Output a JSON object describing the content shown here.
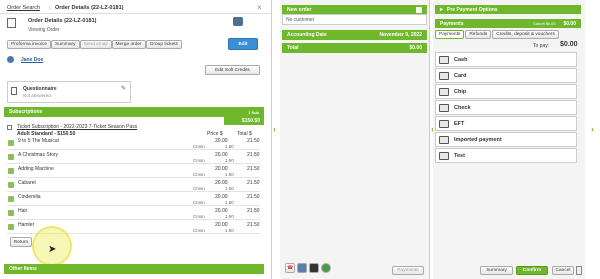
{
  "left": {
    "tabs": [
      "Order Search",
      "Order Details (22-LZ-0181)"
    ],
    "header_title": "Order Details (22-LZ-0181)",
    "header_sub": "Viewing Order",
    "edit_label": "Edit",
    "toolbar": [
      "Proforma invoice",
      "Summary",
      "Send email",
      "Merge order",
      "Group tickets"
    ],
    "customer_name": "Jane Doe",
    "edit_soft_credits": "Edit Soft Credits",
    "questionnaire_title": "Questionnaire",
    "questionnaire_status": "Not answered",
    "subscriptions": {
      "title": "Subscriptions",
      "count_label": "1 Sub",
      "total": "$150.50",
      "item_link": "Ticket Subscription - 2022-2023 7-Ticket Season Pass",
      "item_line": "Adult Standard - $150.50",
      "col_price": "Price $",
      "col_total": "Total $",
      "rows": [
        {
          "name": "9 to 5 The Musical",
          "price": "20.00",
          "total": "21.50",
          "comp": "Cmsn",
          "fee": "1.50"
        },
        {
          "name": "A Christmas Story",
          "price": "20.00",
          "total": "21.50",
          "comp": "Cmsn",
          "fee": "1.50"
        },
        {
          "name": "Adding Machine",
          "price": "20.00",
          "total": "21.50",
          "comp": "Cmsn",
          "fee": "1.50"
        },
        {
          "name": "Cabaret",
          "price": "20.00",
          "total": "21.50",
          "comp": "Cmsn",
          "fee": "1.50"
        },
        {
          "name": "Cinderella",
          "price": "20.00",
          "total": "21.50",
          "comp": "Cmsn",
          "fee": "1.50"
        },
        {
          "name": "Hair",
          "price": "20.00",
          "total": "21.50",
          "comp": "Cmsn",
          "fee": "1.50"
        },
        {
          "name": "Hamlet",
          "price": "20.00",
          "total": "21.50",
          "comp": "Cmsn",
          "fee": "1.50"
        }
      ],
      "return_label": "Return"
    },
    "other_items": "Other Items"
  },
  "middle": {
    "new_order": "New order",
    "no_customer": "No customer",
    "accounting_label": "Accounting Date",
    "accounting_date": "November 9, 2022",
    "total_label": "Total",
    "total_value": "$0.00",
    "payments_btn": "Payments"
  },
  "right": {
    "pre_payment": "Pre Payment Options",
    "payments_label": "Payments",
    "cancel_label": "Cancel $0.00",
    "payments_value": "$0.00",
    "tabs": [
      "Payments",
      "Refunds",
      "Credits, deposit & vouchers"
    ],
    "to_pay_label": "To pay:",
    "to_pay_value": "$0.00",
    "methods": [
      "Cash",
      "Card",
      "Chip",
      "Check",
      "EFT",
      "Imported payment",
      "Test"
    ],
    "summary_btn": "Summary",
    "confirm_btn": "Confirm",
    "cancel_btn": "Cancel"
  },
  "colors": {
    "accent": "#6fb82b",
    "edit_blue": "#3b8fd6"
  }
}
